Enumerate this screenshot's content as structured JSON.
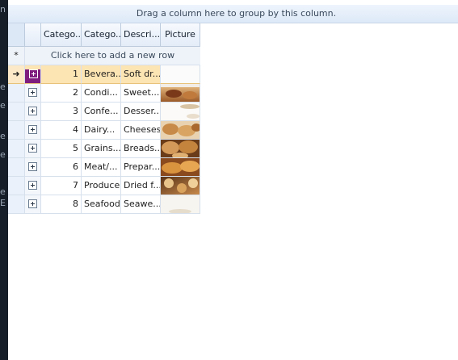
{
  "group_panel": {
    "text": "Drag a column here to group by this column."
  },
  "left_strip": {
    "glyphs": [
      "n",
      "e",
      "e",
      "e",
      "e",
      "e",
      "E"
    ]
  },
  "columns": [
    "Catego...",
    "Catego...",
    "Descri...",
    "Picture"
  ],
  "new_row": {
    "star": "*",
    "text": "Click here to add a new row"
  },
  "current_row_indicator": "➜",
  "rows": [
    {
      "id": "1",
      "name": "Bevera...",
      "desc": "Soft dr...",
      "picture": "picture-blank"
    },
    {
      "id": "2",
      "name": "Condi...",
      "desc": "Sweet...",
      "picture": "picture-condiments"
    },
    {
      "id": "3",
      "name": "Confe...",
      "desc": "Desser...",
      "picture": "picture-confections"
    },
    {
      "id": "4",
      "name": "Dairy...",
      "desc": "Cheeses",
      "picture": "picture-dairy"
    },
    {
      "id": "5",
      "name": "Grains...",
      "desc": "Breads...",
      "picture": "picture-grains"
    },
    {
      "id": "6",
      "name": "Meat/...",
      "desc": "Prepar...",
      "picture": "picture-meat"
    },
    {
      "id": "7",
      "name": "Produce",
      "desc": "Dried f...",
      "picture": "picture-produce"
    },
    {
      "id": "8",
      "name": "Seafood",
      "desc": "Seawe...",
      "picture": "picture-seafood"
    }
  ],
  "selected_row": 0
}
